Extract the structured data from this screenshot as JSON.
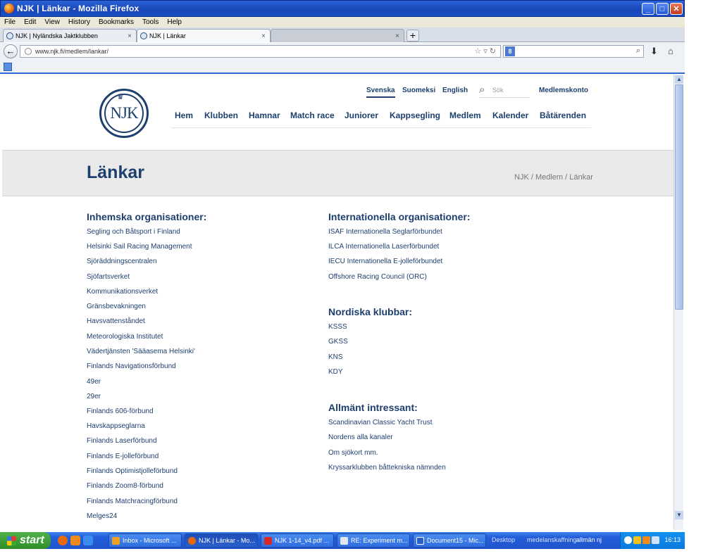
{
  "window": {
    "title": "NJK | Länkar - Mozilla Firefox"
  },
  "menu": [
    "File",
    "Edit",
    "View",
    "History",
    "Bookmarks",
    "Tools",
    "Help"
  ],
  "tabs": [
    {
      "label": "NJK | Nyländska Jaktklubben",
      "active": false
    },
    {
      "label": "NJK | Länkar",
      "active": true
    },
    {
      "label": "",
      "active": false
    }
  ],
  "address": {
    "url": "www.njk.fi/medlem/lankar/"
  },
  "site": {
    "logo_text": "NJK",
    "lang": [
      "Svenska",
      "Suomeksi",
      "English"
    ],
    "search_placeholder": "Sök",
    "account": "Medlemskonto",
    "nav": [
      "Hem",
      "Klubben",
      "Hamnar",
      "Match race",
      "Juniorer",
      "Kappsegling",
      "Medlem",
      "Kalender",
      "Båtärenden"
    ],
    "page_title": "Länkar",
    "breadcrumb": "NJK / Medlem / Länkar",
    "domestic": {
      "heading": "Inhemska organisationer:",
      "links": [
        "Segling och Båtsport i Finland",
        "Helsinki Sail Racing Management",
        "Sjöräddningscentralen",
        "Sjöfartsverket",
        "Kommunikationsverket",
        "Gränsbevakningen",
        "Havsvattenståndet",
        "Meteorologiska Institutet",
        "Vädertjänsten 'Sääasema Helsinki'",
        "Finlands Navigationsförbund",
        "49er",
        "29er",
        "Finlands 606-förbund",
        "Havskappseglarna",
        "Finlands Laserförbund",
        "Finlands E-jolleförbund",
        "Finlands Optimistjolleförbund",
        "Finlands Zoom8-förbund",
        "Finlands Matchracingförbund",
        "Melges24"
      ]
    },
    "international": {
      "heading": "Internationella organisationer:",
      "links": [
        "ISAF Internationella Seglarförbundet",
        "ILCA Internationella Laserförbundet",
        "IECU Internationella E-jolleförbundet",
        "Offshore Racing Council (ORC)"
      ]
    },
    "nordic": {
      "heading": "Nordiska klubbar:",
      "links": [
        "KSSS",
        "GKSS",
        "KNS",
        "KDY"
      ]
    },
    "general": {
      "heading": "Allmänt intressant:",
      "links": [
        "Scandinavian Classic Yacht Trust",
        "Nordens alla kanaler",
        "Om sjökort mm.",
        "Kryssarklubben båttekniska nämnden"
      ]
    }
  },
  "taskbar": {
    "start": "start",
    "tasks": [
      "Inbox - Microsoft ...",
      "NJK | Länkar - Mo...",
      "NJK 1-14_v4.pdf ...",
      "RE: Experiment m...",
      "Document15 - Mic..."
    ],
    "desktop": "Desktop",
    "extra1": "medelanskaffning",
    "extra2": "allmän nj",
    "clock": "16:13"
  },
  "colors": {
    "brand": "#1d3f6e",
    "titlebar": "#1846b6",
    "taskbar": "#245edb"
  }
}
